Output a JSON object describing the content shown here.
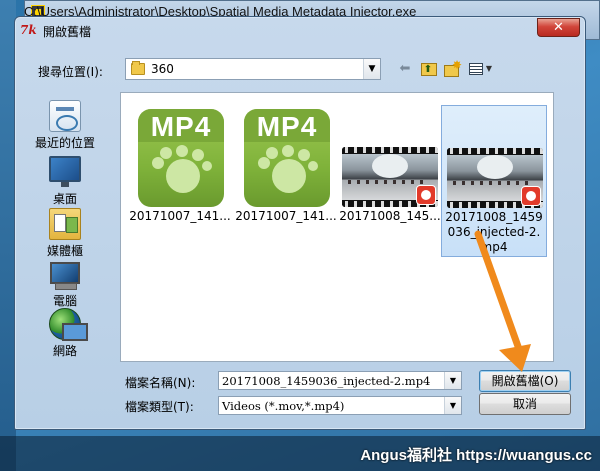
{
  "background_window": {
    "title": "C:\\Users\\Administrator\\Desktop\\Spatial Media Metadata Injector.exe"
  },
  "dialog": {
    "title": "開啟舊檔",
    "close_label": "✕",
    "look_in_label": "搜尋位置(I):",
    "look_in_value": "360",
    "places": [
      {
        "label": "最近的位置",
        "icon": "recent-places-icon"
      },
      {
        "label": "桌面",
        "icon": "desktop-icon"
      },
      {
        "label": "媒體櫃",
        "icon": "libraries-icon"
      },
      {
        "label": "電腦",
        "icon": "computer-icon"
      },
      {
        "label": "網路",
        "icon": "network-icon"
      }
    ],
    "files": [
      {
        "name": "20171007_141...",
        "type": "mp4-icon"
      },
      {
        "name": "20171007_141...",
        "type": "mp4-icon"
      },
      {
        "name": "20171008_145...",
        "type": "video-thumbnail"
      },
      {
        "name": "20171008_1459036_injected-2.mp4",
        "type": "video-thumbnail",
        "selected": true
      }
    ],
    "mp4_icon_text": "MP4",
    "filename_label": "檔案名稱(N):",
    "filename_value": "20171008_1459036_injected-2.mp4",
    "filetype_label": "檔案類型(T):",
    "filetype_value": "Videos (*.mov,*.mp4)",
    "open_button": "開啟舊檔(O)",
    "cancel_button": "取消"
  },
  "watermark": "Angus福利社 https://wuangus.cc",
  "colors": {
    "accent_orange": "#f08a1c",
    "close_red": "#c8382c",
    "mp4_green": "#8dbd45",
    "selection_blue": "#cce4f9"
  }
}
